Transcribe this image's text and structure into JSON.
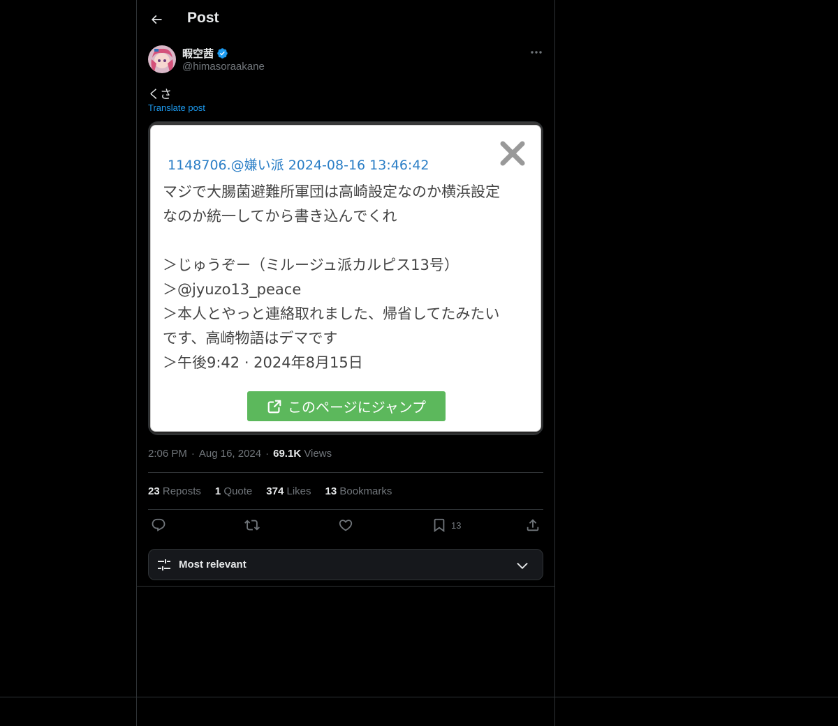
{
  "header": {
    "title": "Post"
  },
  "author": {
    "display_name": "暇空茜",
    "handle": "@himasoraakane",
    "verified": true
  },
  "post": {
    "text": "くさ",
    "translate_label": "Translate post"
  },
  "media": {
    "header": "1148706.@嫌い派 2024-08-16 13:46:42",
    "lines": [
      "マジで大腸菌避難所軍団は高崎設定なのか横浜設定",
      "なのか統一してから書き込んでくれ",
      "",
      "＞じゅうぞー（ミルージュ派カルピス13号）",
      "＞@jyuzo13_peace",
      "＞本人とやっと連絡取れました、帰省してたみたい",
      "です、高崎物語はデマです",
      "＞午後9:42 · 2024年8月15日"
    ],
    "jump_label": "このページにジャンプ"
  },
  "meta": {
    "time": "2:06 PM",
    "sep": "·",
    "date": "Aug 16, 2024",
    "views_count": "69.1K",
    "views_label": "Views"
  },
  "stats": {
    "reposts_count": "23",
    "reposts_label": "Reposts",
    "quotes_count": "1",
    "quotes_label": "Quote",
    "likes_count": "374",
    "likes_label": "Likes",
    "bookmarks_count": "13",
    "bookmarks_label": "Bookmarks"
  },
  "actions": {
    "bookmark_count": "13"
  },
  "sort": {
    "label": "Most relevant"
  },
  "colors": {
    "background": "#000000",
    "accent": "#1d9bf0",
    "muted": "#71767b",
    "jump_button": "#5cb85c"
  }
}
